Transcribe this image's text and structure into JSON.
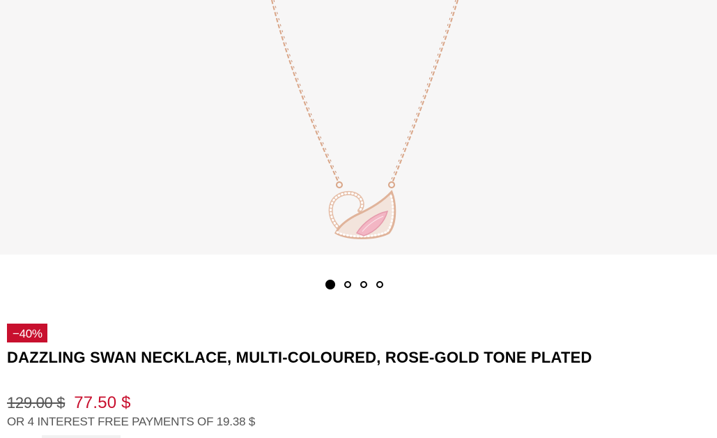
{
  "product": {
    "image_icon": "swan-necklace-image",
    "discount_badge": "−40%",
    "title": "DAZZLING SWAN NECKLACE, MULTI-COLOURED, ROSE-GOLD TONE PLATED",
    "old_price": "129.00 $",
    "new_price": "77.50 $",
    "installments": "OR 4 INTEREST FREE PAYMENTS OF 19.38 $"
  },
  "carousel": {
    "slide_count": 4,
    "active_index": 0
  },
  "colors": {
    "sale_red": "#c8102e",
    "image_background": "#f7f6f6",
    "chain_rose_gold": "#d9a587",
    "crystal_pink": "#f3b6c4"
  }
}
